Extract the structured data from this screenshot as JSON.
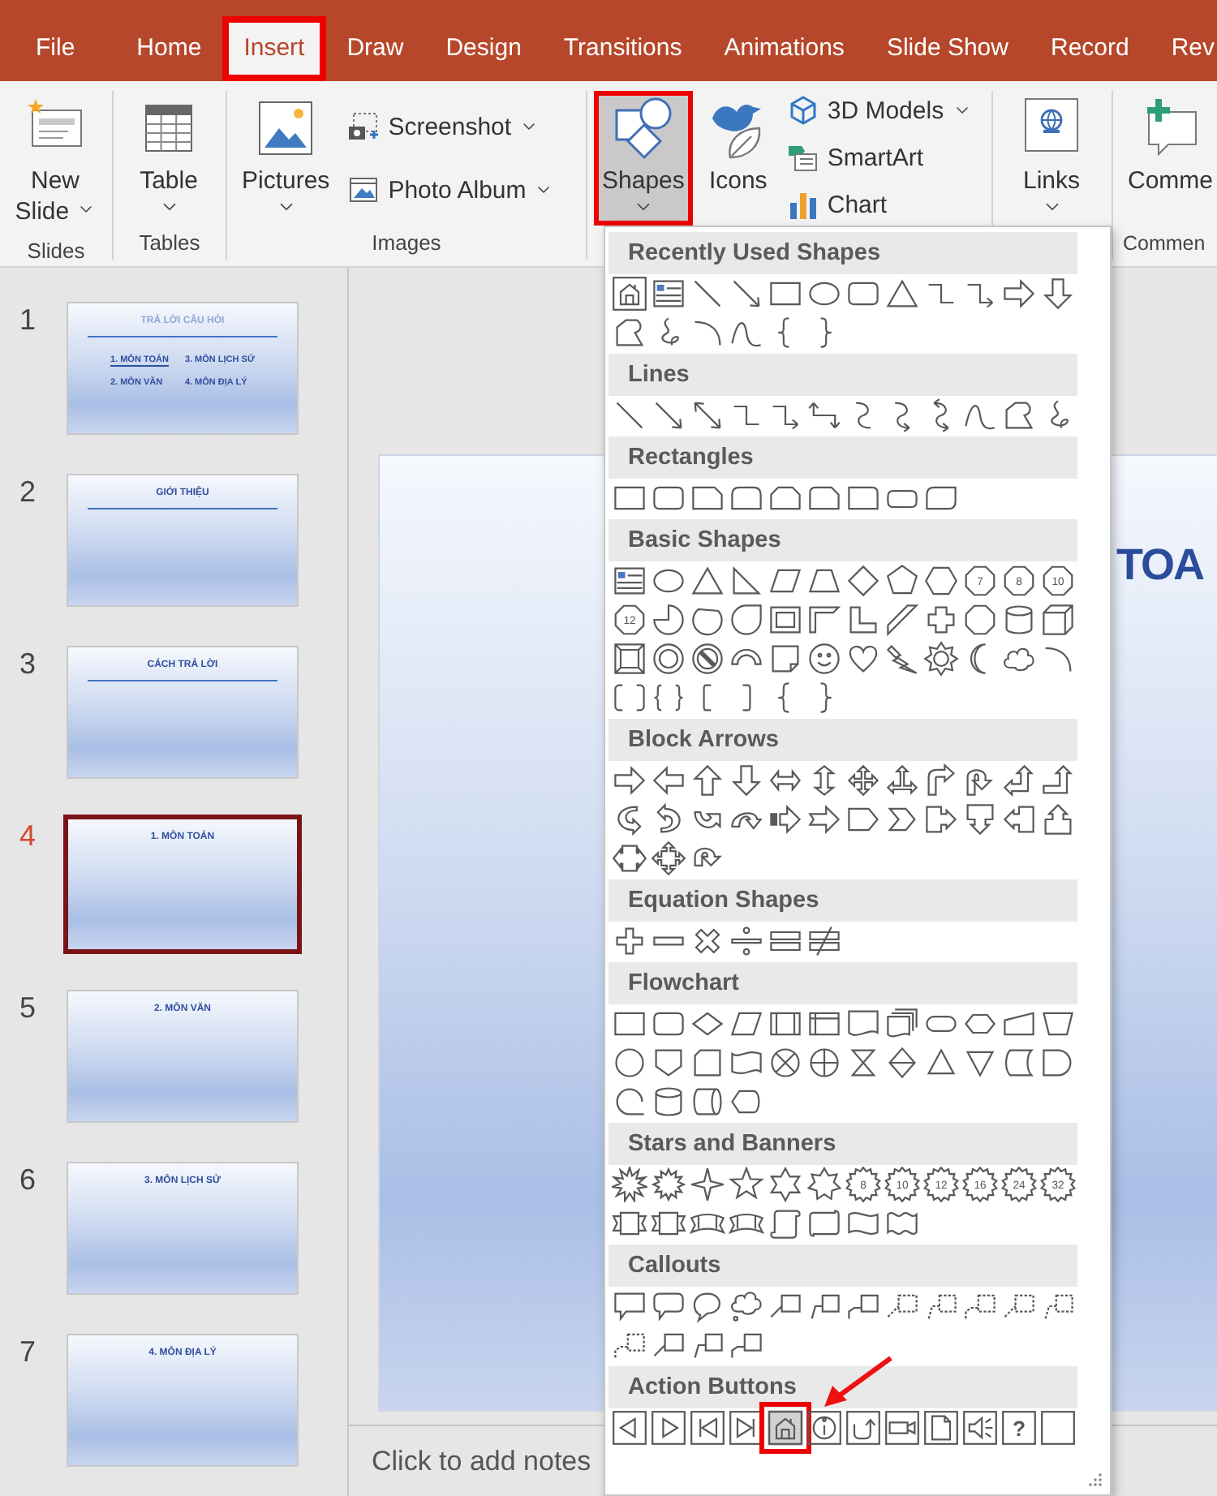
{
  "tabs": [
    {
      "label": "File",
      "selected": false,
      "highlighted": false
    },
    {
      "label": "Home",
      "selected": false,
      "highlighted": false
    },
    {
      "label": "Insert",
      "selected": true,
      "highlighted": true
    },
    {
      "label": "Draw",
      "selected": false,
      "highlighted": false
    },
    {
      "label": "Design",
      "selected": false,
      "highlighted": false
    },
    {
      "label": "Transitions",
      "selected": false,
      "highlighted": false
    },
    {
      "label": "Animations",
      "selected": false,
      "highlighted": false
    },
    {
      "label": "Slide Show",
      "selected": false,
      "highlighted": false
    },
    {
      "label": "Record",
      "selected": false,
      "highlighted": false
    },
    {
      "label": "Rev",
      "selected": false,
      "highlighted": false
    }
  ],
  "ribbon": {
    "slides_group": {
      "label": "Slides",
      "new_slide": "New Slide"
    },
    "tables_group": {
      "label": "Tables",
      "table": "Table"
    },
    "images_group": {
      "label": "Images",
      "pictures": "Pictures",
      "screenshot": "Screenshot",
      "photo_album": "Photo Album"
    },
    "illustrations_group": {
      "shapes": {
        "label": "Shapes",
        "pressed": true,
        "highlighted": true
      },
      "icons": "Icons",
      "models_3d": "3D Models",
      "smartart": "SmartArt",
      "chart": "Chart"
    },
    "links_group": {
      "links": "Links"
    },
    "comments_group": {
      "label": "Commen",
      "comment": "Comme"
    }
  },
  "slides": [
    {
      "number": "1",
      "kind": "agenda",
      "title": "TRẢ LỜI CÂU HỎI",
      "selected": false,
      "items": [
        {
          "text": "1. MÔN TOÁN",
          "underlined": true
        },
        {
          "text": "3. MÔN LỊCH SỬ",
          "underlined": false
        },
        {
          "text": "2. MÔN VĂN",
          "underlined": false
        },
        {
          "text": "4. MÔN ĐỊA LÝ",
          "underlined": false
        }
      ]
    },
    {
      "number": "2",
      "kind": "title-rule",
      "title": "GIỚI THIỆU",
      "selected": false
    },
    {
      "number": "3",
      "kind": "title-rule",
      "title": "CÁCH TRẢ LỜI",
      "selected": false
    },
    {
      "number": "4",
      "kind": "title-only",
      "title": "1. MÔN TOÁN",
      "selected": true
    },
    {
      "number": "5",
      "kind": "title-only",
      "title": "2. MÔN VĂN",
      "selected": false
    },
    {
      "number": "6",
      "kind": "title-only",
      "title": "3. MÔN LỊCH SỬ",
      "selected": false
    },
    {
      "number": "7",
      "kind": "title-only",
      "title": "4. MÔN ĐỊA LÝ",
      "selected": false
    }
  ],
  "editor": {
    "slide_title": "TOA",
    "notes_placeholder": "Click to add notes"
  },
  "shapes_gallery": {
    "categories": [
      {
        "title": "Recently Used Shapes",
        "shapes": [
          {
            "kind": "action-home",
            "selected": false
          },
          {
            "kind": "text-box",
            "selected": false
          },
          {
            "kind": "line",
            "selected": false
          },
          {
            "kind": "arrow-line",
            "selected": false
          },
          {
            "kind": "rectangle",
            "selected": false
          },
          {
            "kind": "ellipse",
            "selected": false
          },
          {
            "kind": "rounded-rectangle",
            "selected": false
          },
          {
            "kind": "triangle",
            "selected": false
          },
          {
            "kind": "elbow-connector",
            "selected": false
          },
          {
            "kind": "elbow-arrow",
            "selected": false
          },
          {
            "kind": "right-arrow",
            "selected": false
          },
          {
            "kind": "down-arrow",
            "selected": false
          },
          {
            "kind": "freeform",
            "selected": false
          },
          {
            "kind": "scribble",
            "selected": false
          },
          {
            "kind": "arc",
            "selected": false
          },
          {
            "kind": "wave-curve",
            "selected": false
          },
          {
            "kind": "left-brace",
            "selected": false
          },
          {
            "kind": "right-brace",
            "selected": false
          }
        ]
      },
      {
        "title": "Lines",
        "shapes": [
          {
            "kind": "line",
            "selected": false
          },
          {
            "kind": "arrow-line",
            "selected": false
          },
          {
            "kind": "double-arrow-line",
            "selected": false
          },
          {
            "kind": "elbow-connector",
            "selected": false
          },
          {
            "kind": "elbow-arrow",
            "selected": false
          },
          {
            "kind": "elbow-double-arrow",
            "selected": false
          },
          {
            "kind": "curve",
            "selected": false
          },
          {
            "kind": "curve-arrow",
            "selected": false
          },
          {
            "kind": "curve-double-arrow",
            "selected": false
          },
          {
            "kind": "wave-curve",
            "selected": false
          },
          {
            "kind": "freeform",
            "selected": false
          },
          {
            "kind": "scribble",
            "selected": false
          }
        ]
      },
      {
        "title": "Rectangles",
        "shapes": [
          {
            "kind": "rectangle",
            "selected": false
          },
          {
            "kind": "rounded-rectangle",
            "selected": false
          },
          {
            "kind": "snip-corner-rectangle",
            "selected": false
          },
          {
            "kind": "round-top-rectangle",
            "selected": false
          },
          {
            "kind": "snip-top-rectangle",
            "selected": false
          },
          {
            "kind": "snip-round-rectangle",
            "selected": false
          },
          {
            "kind": "round-corner-rectangle",
            "selected": false
          },
          {
            "kind": "flat-rounded-rectangle",
            "selected": false
          },
          {
            "kind": "round-diagonal-rectangle",
            "selected": false
          }
        ]
      },
      {
        "title": "Basic Shapes",
        "shapes": [
          {
            "kind": "text-box",
            "selected": false
          },
          {
            "kind": "ellipse",
            "selected": false
          },
          {
            "kind": "triangle",
            "selected": false
          },
          {
            "kind": "right-triangle",
            "selected": false
          },
          {
            "kind": "parallelogram",
            "selected": false
          },
          {
            "kind": "trapezoid",
            "selected": false
          },
          {
            "kind": "diamond",
            "selected": false
          },
          {
            "kind": "pentagon",
            "selected": false
          },
          {
            "kind": "hexagon",
            "selected": false
          },
          {
            "kind": "numbered-polygon",
            "label": "7",
            "selected": false
          },
          {
            "kind": "numbered-polygon",
            "label": "8",
            "selected": false
          },
          {
            "kind": "numbered-polygon",
            "label": "10",
            "selected": false
          },
          {
            "kind": "numbered-polygon",
            "label": "12",
            "selected": false
          },
          {
            "kind": "pie",
            "selected": false
          },
          {
            "kind": "chord",
            "selected": false
          },
          {
            "kind": "teardrop",
            "selected": false
          },
          {
            "kind": "frame",
            "selected": false
          },
          {
            "kind": "half-frame",
            "selected": false
          },
          {
            "kind": "l-shape",
            "selected": false
          },
          {
            "kind": "diagonal-stripe",
            "selected": false
          },
          {
            "kind": "cross",
            "selected": false
          },
          {
            "kind": "octagon",
            "selected": false
          },
          {
            "kind": "cylinder",
            "selected": false
          },
          {
            "kind": "cube",
            "selected": false
          },
          {
            "kind": "bevel",
            "selected": false
          },
          {
            "kind": "donut",
            "selected": false
          },
          {
            "kind": "no-symbol",
            "selected": false
          },
          {
            "kind": "block-arc",
            "selected": false
          },
          {
            "kind": "folded-corner",
            "selected": false
          },
          {
            "kind": "smiley",
            "selected": false
          },
          {
            "kind": "heart",
            "selected": false
          },
          {
            "kind": "lightning",
            "selected": false
          },
          {
            "kind": "sun",
            "selected": false
          },
          {
            "kind": "moon",
            "selected": false
          },
          {
            "kind": "cloud",
            "selected": false
          },
          {
            "kind": "arc",
            "selected": false
          },
          {
            "kind": "double-bracket",
            "selected": false
          },
          {
            "kind": "double-brace",
            "selected": false
          },
          {
            "kind": "left-bracket",
            "selected": false
          },
          {
            "kind": "right-bracket",
            "selected": false
          },
          {
            "kind": "left-brace",
            "selected": false
          },
          {
            "kind": "right-brace",
            "selected": false
          }
        ]
      },
      {
        "title": "Block Arrows",
        "shapes": [
          {
            "kind": "right-arrow",
            "selected": false
          },
          {
            "kind": "left-arrow",
            "selected": false
          },
          {
            "kind": "up-arrow",
            "selected": false
          },
          {
            "kind": "down-arrow",
            "selected": false
          },
          {
            "kind": "left-right-arrow",
            "selected": false
          },
          {
            "kind": "up-down-arrow",
            "selected": false
          },
          {
            "kind": "quad-arrow",
            "selected": false
          },
          {
            "kind": "left-right-up-arrow",
            "selected": false
          },
          {
            "kind": "bent-arrow",
            "selected": false
          },
          {
            "kind": "u-turn-arrow",
            "selected": false
          },
          {
            "kind": "left-up-arrow",
            "selected": false
          },
          {
            "kind": "bent-up-arrow",
            "selected": false
          },
          {
            "kind": "curved-right-arrow",
            "selected": false
          },
          {
            "kind": "curved-left-arrow",
            "selected": false
          },
          {
            "kind": "curved-up-arrow",
            "selected": false
          },
          {
            "kind": "curved-down-arrow",
            "selected": false
          },
          {
            "kind": "striped-right-arrow",
            "selected": false
          },
          {
            "kind": "notched-right-arrow",
            "selected": false
          },
          {
            "kind": "pentagon-arrow",
            "selected": false
          },
          {
            "kind": "chevron",
            "selected": false
          },
          {
            "kind": "right-callout-arrow",
            "selected": false
          },
          {
            "kind": "down-callout-arrow",
            "selected": false
          },
          {
            "kind": "left-callout-arrow",
            "selected": false
          },
          {
            "kind": "up-callout-arrow",
            "selected": false
          },
          {
            "kind": "left-right-callout-arrow",
            "selected": false
          },
          {
            "kind": "quad-callout-arrow",
            "selected": false
          },
          {
            "kind": "circular-arrow",
            "selected": false
          }
        ]
      },
      {
        "title": "Equation Shapes",
        "shapes": [
          {
            "kind": "plus",
            "selected": false
          },
          {
            "kind": "minus",
            "selected": false
          },
          {
            "kind": "multiply",
            "selected": false
          },
          {
            "kind": "divide",
            "selected": false
          },
          {
            "kind": "equal",
            "selected": false
          },
          {
            "kind": "not-equal",
            "selected": false
          }
        ]
      },
      {
        "title": "Flowchart",
        "shapes": [
          {
            "kind": "process",
            "selected": false
          },
          {
            "kind": "alternate-process",
            "selected": false
          },
          {
            "kind": "decision",
            "selected": false
          },
          {
            "kind": "data",
            "selected": false
          },
          {
            "kind": "predefined-process",
            "selected": false
          },
          {
            "kind": "internal-storage",
            "selected": false
          },
          {
            "kind": "document",
            "selected": false
          },
          {
            "kind": "multidocument",
            "selected": false
          },
          {
            "kind": "terminator",
            "selected": false
          },
          {
            "kind": "preparation",
            "selected": false
          },
          {
            "kind": "manual-input",
            "selected": false
          },
          {
            "kind": "manual-operation",
            "selected": false
          },
          {
            "kind": "connector",
            "selected": false
          },
          {
            "kind": "off-page-connector",
            "selected": false
          },
          {
            "kind": "card",
            "selected": false
          },
          {
            "kind": "punched-tape",
            "selected": false
          },
          {
            "kind": "summing-junction",
            "selected": false
          },
          {
            "kind": "or",
            "selected": false
          },
          {
            "kind": "collate",
            "selected": false
          },
          {
            "kind": "sort",
            "selected": false
          },
          {
            "kind": "extract",
            "selected": false
          },
          {
            "kind": "merge",
            "selected": false
          },
          {
            "kind": "stored-data",
            "selected": false
          },
          {
            "kind": "delay",
            "selected": false
          },
          {
            "kind": "sequential-storage",
            "selected": false
          },
          {
            "kind": "magnetic-disk",
            "selected": false
          },
          {
            "kind": "direct-storage",
            "selected": false
          },
          {
            "kind": "display",
            "selected": false
          }
        ]
      },
      {
        "title": "Stars and Banners",
        "shapes": [
          {
            "kind": "explosion",
            "selected": false
          },
          {
            "kind": "explosion-small",
            "selected": false
          },
          {
            "kind": "star-4",
            "selected": false
          },
          {
            "kind": "star-5",
            "selected": false
          },
          {
            "kind": "star-6",
            "selected": false
          },
          {
            "kind": "star-7",
            "selected": false
          },
          {
            "kind": "numbered-star",
            "label": "8",
            "selected": false
          },
          {
            "kind": "numbered-star",
            "label": "10",
            "selected": false
          },
          {
            "kind": "numbered-star",
            "label": "12",
            "selected": false
          },
          {
            "kind": "numbered-star",
            "label": "16",
            "selected": false
          },
          {
            "kind": "numbered-star",
            "label": "24",
            "selected": false
          },
          {
            "kind": "numbered-star",
            "label": "32",
            "selected": false
          },
          {
            "kind": "ribbon-banner",
            "selected": false
          },
          {
            "kind": "ribbon-banner",
            "selected": false
          },
          {
            "kind": "curved-ribbon-banner",
            "selected": false
          },
          {
            "kind": "curved-ribbon-banner",
            "selected": false
          },
          {
            "kind": "vertical-scroll",
            "selected": false
          },
          {
            "kind": "horizontal-scroll",
            "selected": false
          },
          {
            "kind": "wave",
            "selected": false
          },
          {
            "kind": "double-wave",
            "selected": false
          }
        ]
      },
      {
        "title": "Callouts",
        "shapes": [
          {
            "kind": "speech-rectangle",
            "selected": false
          },
          {
            "kind": "speech-rounded",
            "selected": false
          },
          {
            "kind": "speech-oval",
            "selected": false
          },
          {
            "kind": "speech-cloud",
            "selected": false
          },
          {
            "kind": "line-callout",
            "selected": false
          },
          {
            "kind": "bent-line-callout",
            "selected": false
          },
          {
            "kind": "double-bent-callout",
            "selected": false
          },
          {
            "kind": "dashed-line-callout",
            "selected": false
          },
          {
            "kind": "dashed-bent-line-callout",
            "selected": false
          },
          {
            "kind": "dashed-double-bent-callout",
            "selected": false
          },
          {
            "kind": "dashed-line-callout",
            "selected": false
          },
          {
            "kind": "dashed-bent-line-callout",
            "selected": false
          },
          {
            "kind": "dashed-double-bent-callout",
            "selected": false
          },
          {
            "kind": "line-callout",
            "selected": false
          },
          {
            "kind": "bent-line-callout",
            "selected": false
          },
          {
            "kind": "double-bent-callout",
            "selected": false
          }
        ]
      },
      {
        "title": "Action Buttons",
        "shapes": [
          {
            "kind": "action-back",
            "selected": false
          },
          {
            "kind": "action-forward",
            "selected": false
          },
          {
            "kind": "action-beginning",
            "selected": false
          },
          {
            "kind": "action-end",
            "selected": false
          },
          {
            "kind": "action-home",
            "selected": true,
            "highlighted": true
          },
          {
            "kind": "action-info",
            "selected": false
          },
          {
            "kind": "action-return",
            "selected": false
          },
          {
            "kind": "action-movie",
            "selected": false
          },
          {
            "kind": "action-document",
            "selected": false
          },
          {
            "kind": "action-sound",
            "selected": false
          },
          {
            "kind": "action-help",
            "label": "?",
            "selected": false
          },
          {
            "kind": "action-blank",
            "selected": false
          }
        ]
      }
    ]
  }
}
